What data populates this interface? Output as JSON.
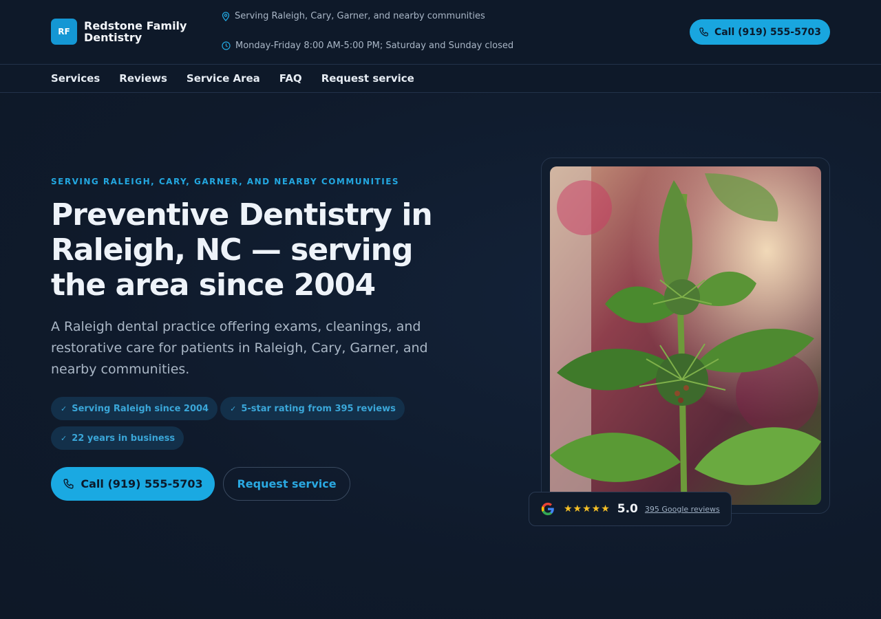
{
  "header": {
    "logo_initials": "RF",
    "logo_name": "Redstone Family Dentistry",
    "service_area": "Serving Raleigh, Cary, Garner, and nearby communities",
    "hours": "Monday-Friday 8:00 AM-5:00 PM; Saturday and Sunday closed",
    "call_label": "Call (919) 555-5703"
  },
  "nav": {
    "items": [
      {
        "label": "Services"
      },
      {
        "label": "Reviews"
      },
      {
        "label": "Service Area"
      },
      {
        "label": "FAQ"
      },
      {
        "label": "Request service"
      }
    ]
  },
  "hero": {
    "eyebrow": "SERVING RALEIGH, CARY, GARNER, AND NEARBY COMMUNITIES",
    "headline": "Preventive Dentistry in Raleigh, NC — serving the area since 2004",
    "subtext": "A Raleigh dental practice offering exams, cleanings, and restorative care for patients in Raleigh, Cary, Garner, and nearby communities.",
    "badges": [
      {
        "label": "Serving Raleigh since 2004"
      },
      {
        "label": "5-star rating from 395 reviews"
      },
      {
        "label": "22 years in business"
      }
    ],
    "call_button": "Call (919) 555-5703",
    "request_button": "Request service"
  },
  "rating": {
    "stars_text": "★★★★★",
    "stars": 5,
    "score": "5.0",
    "link_text": "395 Google reviews"
  },
  "colors": {
    "accent": "#19a6df",
    "background": "#0f1a2b",
    "star": "#f6c026"
  },
  "icons": {
    "location": "map-pin-icon",
    "hours": "clock-icon",
    "phone": "phone-icon",
    "check": "check-icon",
    "google": "google-icon"
  }
}
